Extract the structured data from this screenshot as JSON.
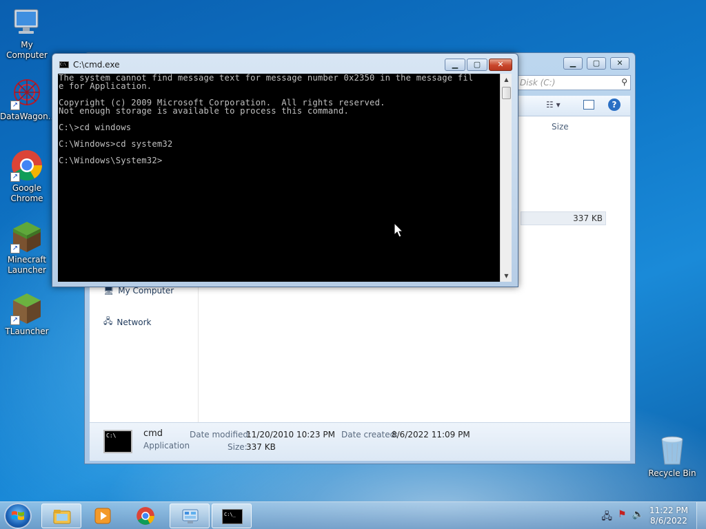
{
  "desktop": {
    "icons": [
      {
        "label": "My Computer",
        "icon": "computer-icon"
      },
      {
        "label": "DataWagon...",
        "icon": "datawagon-icon"
      },
      {
        "label": "Google Chrome",
        "icon": "chrome-icon"
      },
      {
        "label": "Minecraft Launcher",
        "icon": "minecraft-icon"
      },
      {
        "label": "TLauncher",
        "icon": "tlauncher-icon"
      },
      {
        "label": "Recycle Bin",
        "icon": "recycle-bin-icon"
      }
    ]
  },
  "explorer": {
    "search_placeholder": "Disk (C:)",
    "column_size": "Size",
    "row_size": "337 KB",
    "nav": {
      "my_computer": "My Computer",
      "network": "Network"
    },
    "details": {
      "name": "cmd",
      "type": "Application",
      "date_modified_label": "Date modified:",
      "date_modified": "11/20/2010 10:23 PM",
      "size_label": "Size:",
      "size": "337 KB",
      "date_created_label": "Date created:",
      "date_created": "8/6/2022 11:09 PM"
    }
  },
  "cmd": {
    "title": "C:\\cmd.exe",
    "output": "The system cannot find message text for message number 0x2350 in the message fil\ne for Application.\n\nCopyright (c) 2009 Microsoft Corporation.  All rights reserved.\nNot enough storage is available to process this command.\n\nC:\\>cd windows\n\nC:\\Windows>cd system32\n\nC:\\Windows\\System32>",
    "icon_text": "C:\\"
  },
  "taskbar": {
    "pinned": [
      "explorer-icon",
      "media-player-icon",
      "chrome-icon",
      "control-panel-icon",
      "cmd-icon"
    ],
    "cmd_icon_text": "C:\\_",
    "clock_time": "11:22 PM",
    "clock_date": "8/6/2022"
  },
  "colors": {
    "console_bg": "#000000",
    "console_fg": "#c0c0c0",
    "close_red": "#c9462b"
  }
}
